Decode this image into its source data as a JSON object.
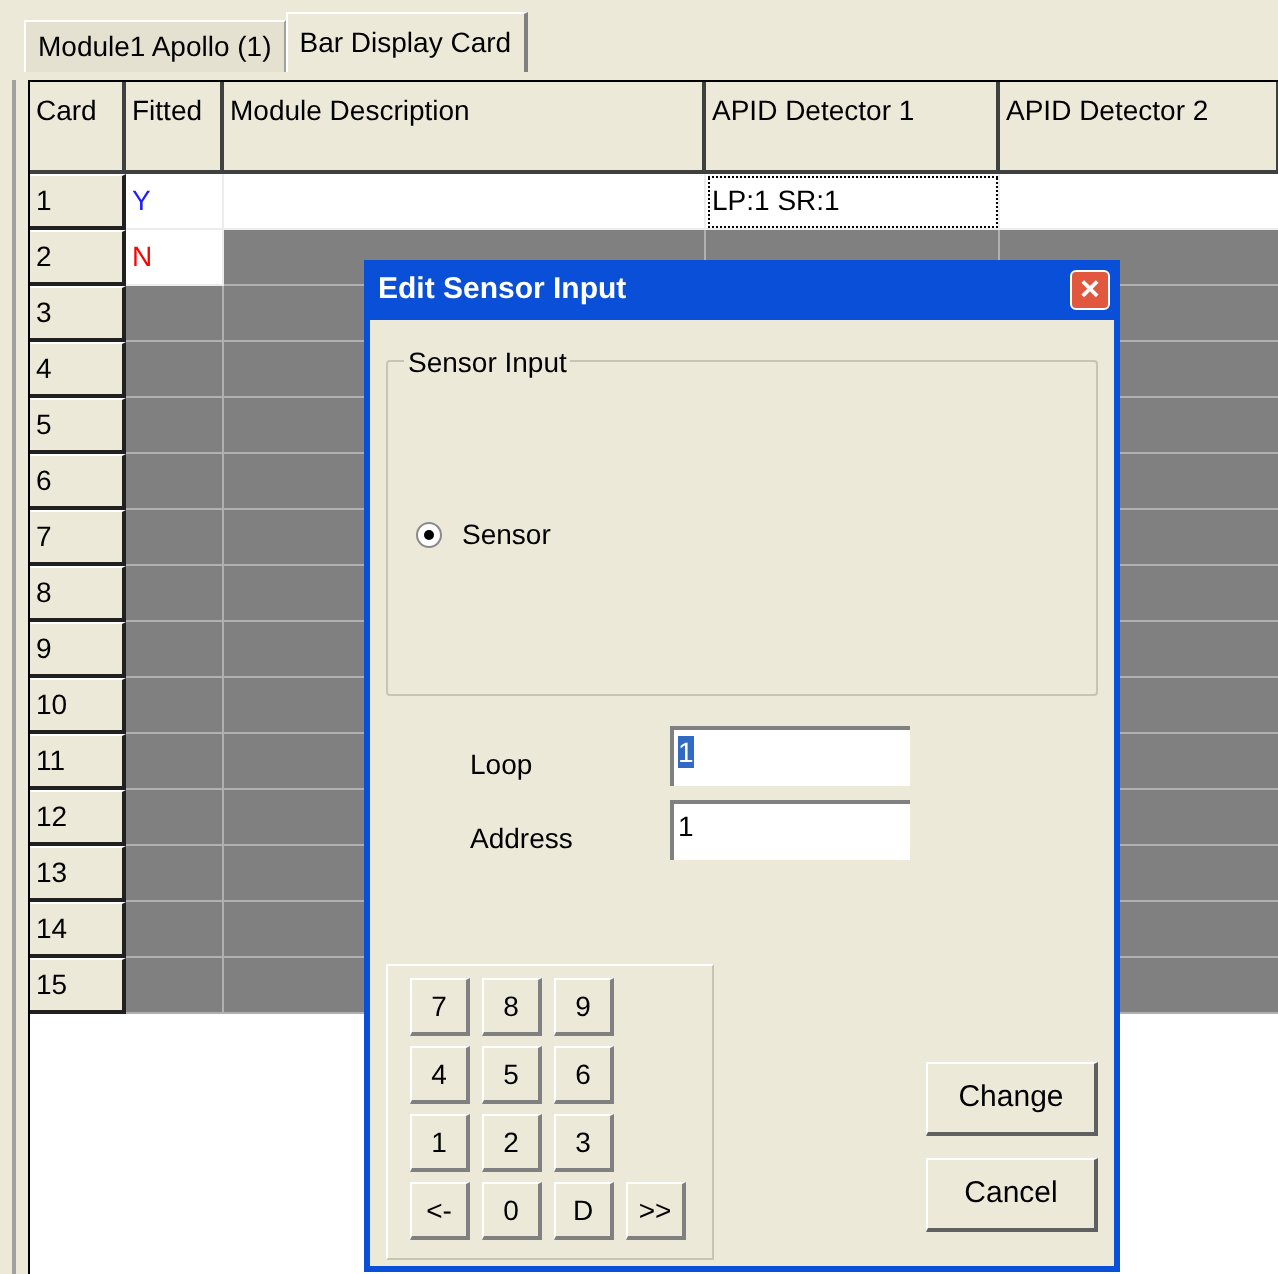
{
  "tabs": [
    {
      "label": "Module1 Apollo (1)",
      "selected": false
    },
    {
      "label": "Bar Display Card",
      "selected": true
    }
  ],
  "table": {
    "columns": [
      "Card",
      "Fitted",
      "Module Description",
      "APID Detector 1",
      "APID Detector 2"
    ],
    "rows": [
      {
        "card": "1",
        "fitted": {
          "text": "Y",
          "color": "#2020ff"
        },
        "active": true,
        "apid_detector_1": {
          "text": "LP:1 SR:1",
          "focused": true
        }
      },
      {
        "card": "2",
        "fitted": {
          "text": "N",
          "color": "#ff0000"
        },
        "active": false
      },
      {
        "card": "3",
        "active": false
      },
      {
        "card": "4",
        "active": false
      },
      {
        "card": "5",
        "active": false
      },
      {
        "card": "6",
        "active": false
      },
      {
        "card": "7",
        "active": false
      },
      {
        "card": "8",
        "active": false
      },
      {
        "card": "9",
        "active": false
      },
      {
        "card": "10",
        "active": false
      },
      {
        "card": "11",
        "active": false
      },
      {
        "card": "12",
        "active": false
      },
      {
        "card": "13",
        "active": false
      },
      {
        "card": "14",
        "active": false
      },
      {
        "card": "15",
        "active": false
      }
    ]
  },
  "dialog": {
    "title": "Edit Sensor Input",
    "close": "×",
    "group_title": "Sensor Input",
    "radios": [
      {
        "label": "Sensor",
        "selected": true
      }
    ],
    "fields": [
      {
        "label": "Loop",
        "value": "1",
        "text_selected": true
      },
      {
        "label": "Address",
        "value": "1",
        "text_selected": false
      }
    ],
    "keypad": [
      [
        "7",
        "8",
        "9"
      ],
      [
        "4",
        "5",
        "6"
      ],
      [
        "1",
        "2",
        "3"
      ],
      [
        "<-",
        "0",
        "D",
        ">>"
      ]
    ],
    "buttons": [
      "Change",
      "Cancel"
    ]
  }
}
